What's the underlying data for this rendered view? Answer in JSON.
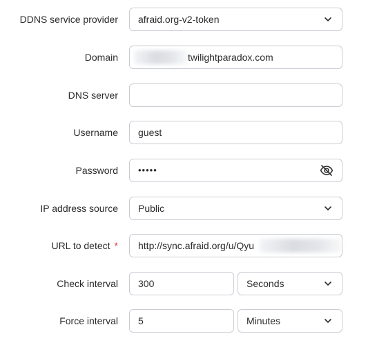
{
  "form": {
    "provider": {
      "label": "DDNS service provider",
      "value": "afraid.org-v2-token",
      "icon": "chevron-down-icon"
    },
    "domain": {
      "label": "Domain",
      "value": "twilightparadox.com"
    },
    "dns_server": {
      "label": "DNS server",
      "value": ""
    },
    "username": {
      "label": "Username",
      "value": "guest"
    },
    "password": {
      "label": "Password",
      "value": "•••••",
      "icon": "eye-off-icon"
    },
    "ip_source": {
      "label": "IP address source",
      "value": "Public",
      "icon": "chevron-down-icon"
    },
    "url_detect": {
      "label": "URL to detect",
      "required_mark": "*",
      "value": "http://sync.afraid.org/u/Qyu"
    },
    "check_interval": {
      "label": "Check interval",
      "value": "300",
      "unit": "Seconds"
    },
    "force_interval": {
      "label": "Force interval",
      "value": "5",
      "unit": "Minutes"
    }
  },
  "colors": {
    "border": "#c9cdd3",
    "text": "#2b2b2b",
    "required": "#d83b3b"
  }
}
